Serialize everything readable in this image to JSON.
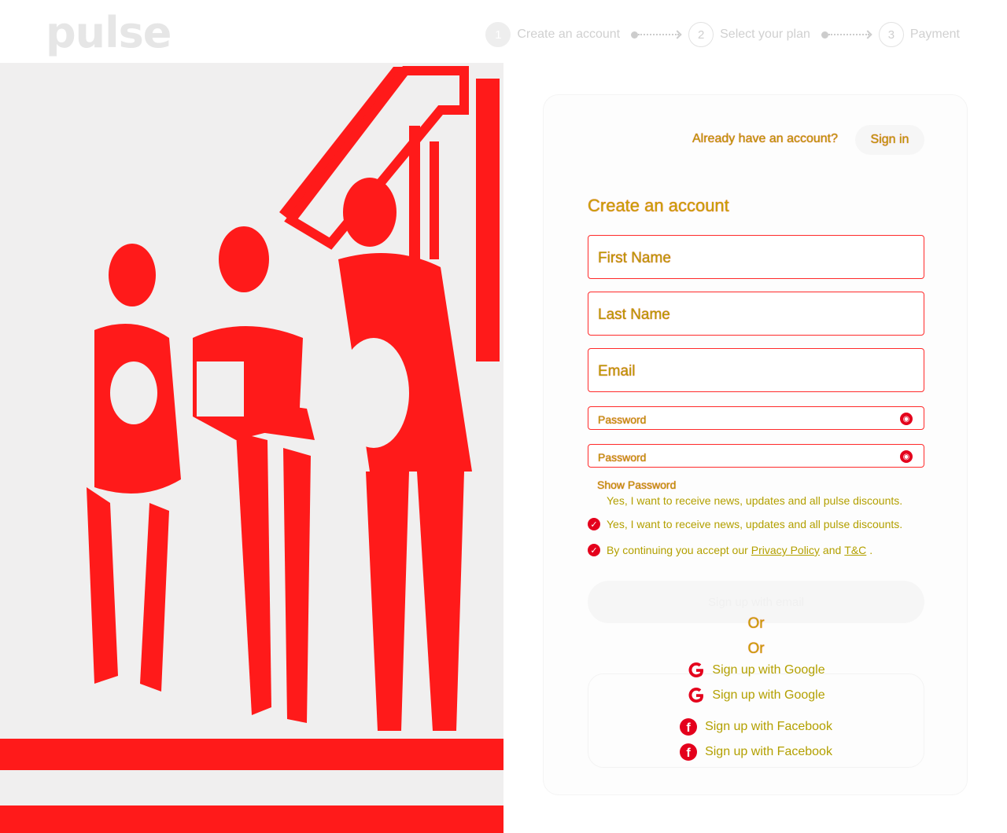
{
  "brand": {
    "logo": "pulse"
  },
  "stepper": {
    "steps": [
      {
        "num": "1",
        "label": "Create an account"
      },
      {
        "num": "2",
        "label": "Select your plan"
      },
      {
        "num": "3",
        "label": "Payment"
      }
    ]
  },
  "signin": {
    "prompt": "Already have an account?",
    "button": "Sign in"
  },
  "form": {
    "title": "Create an account",
    "first_name": "First Name",
    "last_name": "Last Name",
    "email": "Email",
    "password": "Password",
    "password_confirm": "Password",
    "show_password": "Show Password",
    "news_text": "Yes, I want to receive news, updates and all pulse discounts.",
    "consent_prefix": "By continuing you accept our",
    "privacy_link": "Privacy Policy",
    "and": "and",
    "terms_link": "T&C",
    "terms_suffix": "."
  },
  "signup": {
    "email_button": "Sign up with email",
    "or": "Or",
    "google": "Sign up with Google",
    "facebook": "Sign up with Facebook"
  },
  "colors": {
    "accent": "#e4001c",
    "text_overlay": "#b3a000"
  }
}
